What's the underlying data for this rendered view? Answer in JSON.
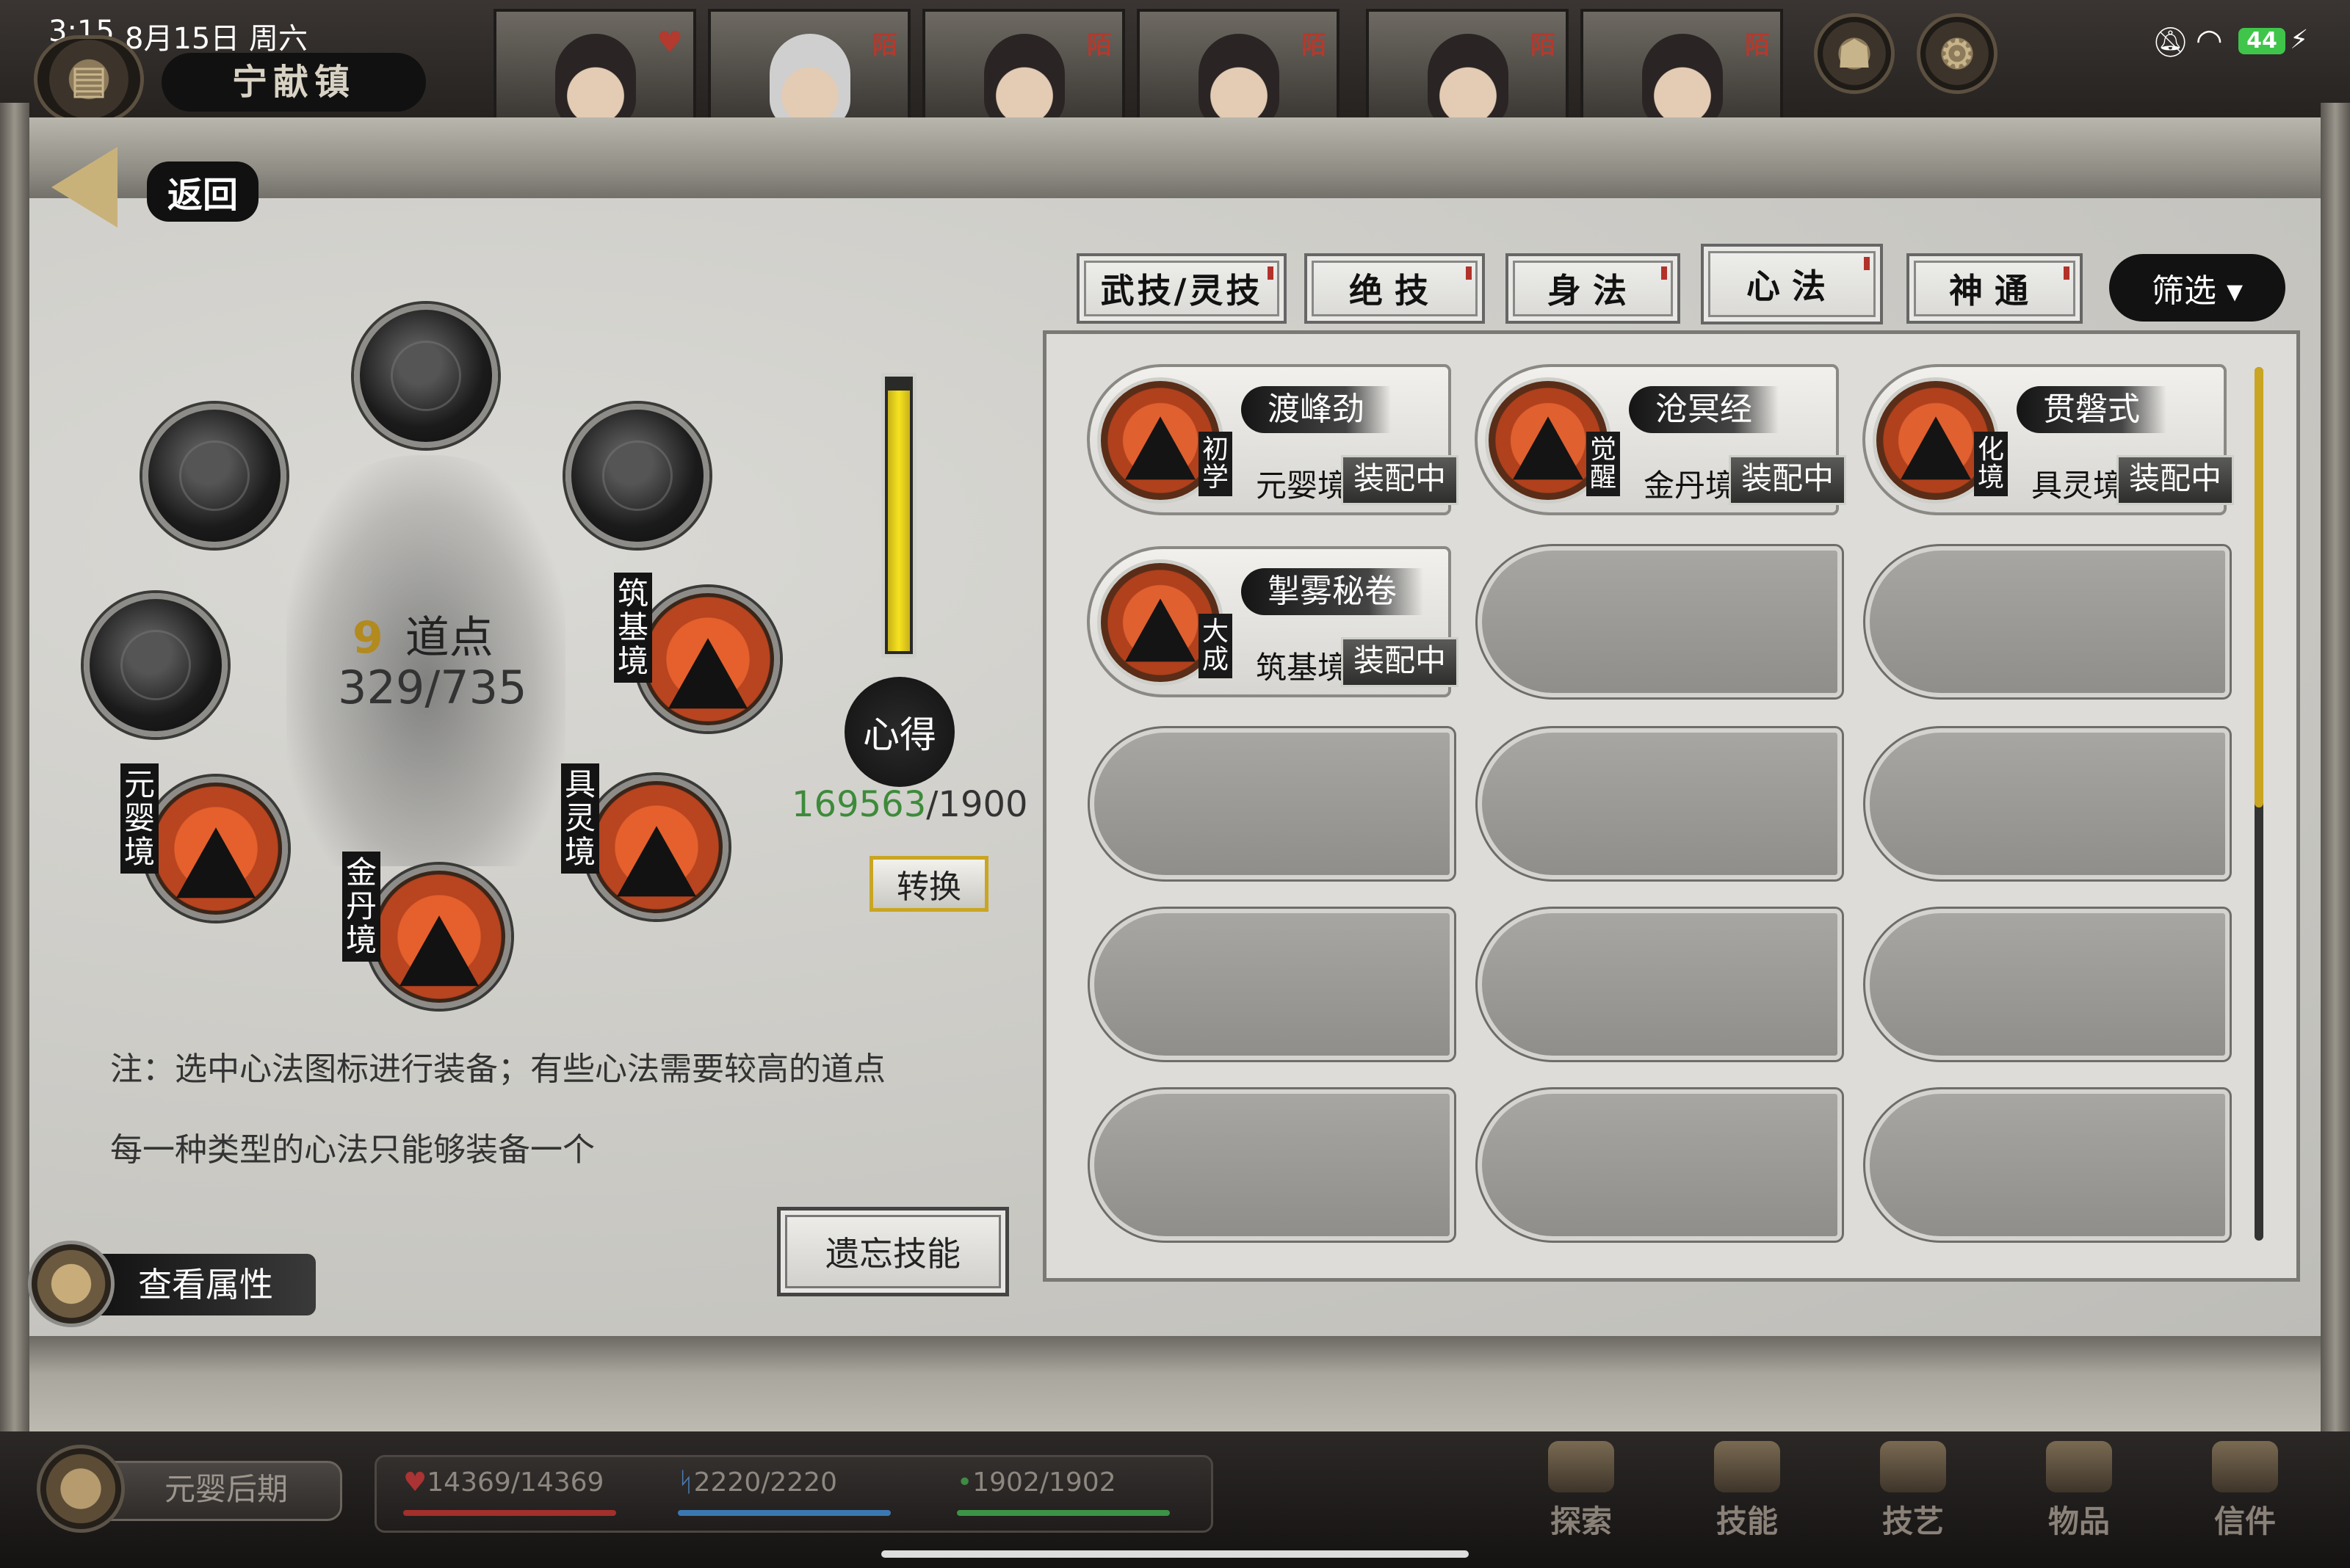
{
  "status": {
    "time": "3:15",
    "date": "8月15日 周六",
    "battery": "44"
  },
  "location": "宁献镇",
  "party_tag": "陌",
  "back_label": "返回",
  "tabs": [
    {
      "label": "武技/灵技",
      "active": false
    },
    {
      "label": "绝技",
      "active": false
    },
    {
      "label": "身法",
      "active": false
    },
    {
      "label": "心法",
      "active": true
    },
    {
      "label": "神通",
      "active": false
    }
  ],
  "filter_label": "筛选 ▾",
  "skills": [
    {
      "name": "渡峰劲",
      "stage": "初学",
      "realm": "元婴境",
      "status": "装配中"
    },
    {
      "name": "沧冥经",
      "stage": "觉醒",
      "realm": "金丹境",
      "status": "装配中"
    },
    {
      "name": "贯磐式",
      "stage": "化境",
      "realm": "具灵境",
      "status": "装配中"
    },
    {
      "name": "掣雾秘卷",
      "stage": "大成",
      "realm": "筑基境",
      "status": "装配中"
    }
  ],
  "dao": {
    "count": "9",
    "unit": "道点",
    "progress": "329/735"
  },
  "slots_equipped": [
    {
      "label": "筑基境"
    },
    {
      "label": "具灵境"
    },
    {
      "label": "金丹境"
    },
    {
      "label": "元婴境"
    }
  ],
  "xinde": {
    "label": "心得",
    "value": "169563",
    "cap": "/1900",
    "bar_fill": 0.96
  },
  "convert_label": "转换",
  "notes": [
    "注：选中心法图标进行装备；有些心法需要较高的道点",
    "每一种类型的心法只能够装备一个"
  ],
  "forget_label": "遗忘技能",
  "view_attr_label": "查看属性",
  "player": {
    "realm": "元婴后期",
    "hp": "14369/14369",
    "mp": "2220/2220",
    "sp": "1902/1902"
  },
  "nav": [
    "探索",
    "技能",
    "技艺",
    "物品",
    "信件"
  ],
  "colors": {
    "accent_orange": "#e5602c",
    "xinde_green": "#3d8b3a",
    "bar_yellow": "#f6e21f"
  }
}
